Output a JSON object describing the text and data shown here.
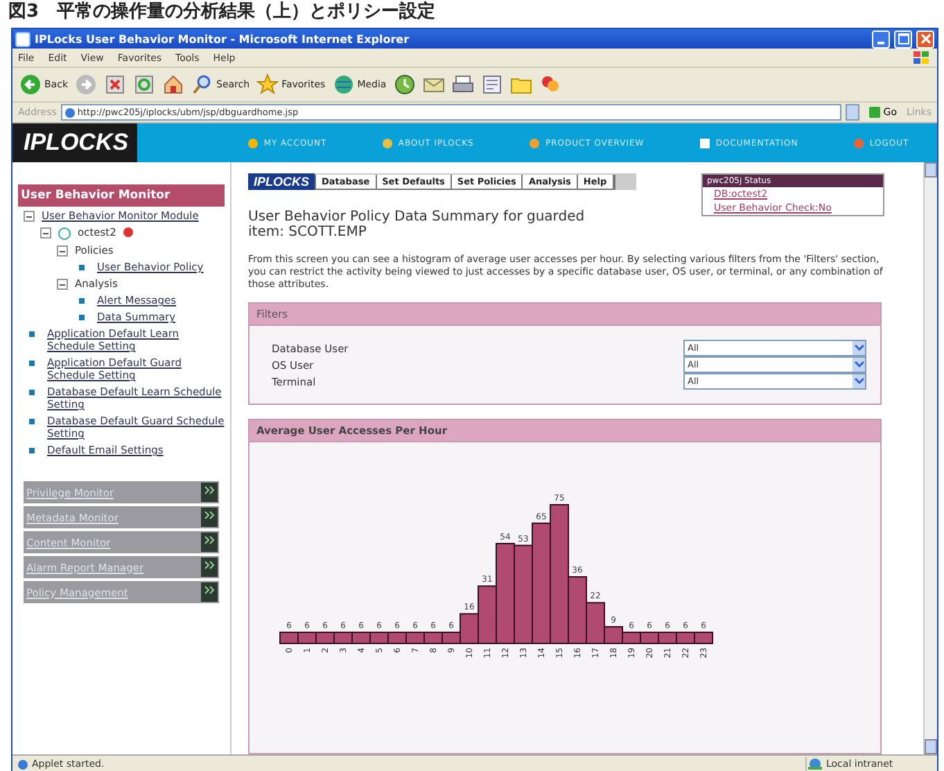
{
  "caption": "図3　平常の操作量の分析結果（上）とポリシー設定",
  "window": {
    "title": "IPLocks User Behavior Monitor - Microsoft Internet Explorer"
  },
  "menu": [
    "File",
    "Edit",
    "View",
    "Favorites",
    "Tools",
    "Help"
  ],
  "toolbar": [
    {
      "kind": "back",
      "label": "Back"
    },
    {
      "kind": "forward"
    },
    {
      "kind": "stop"
    },
    {
      "kind": "refresh"
    },
    {
      "kind": "home"
    },
    {
      "kind": "search",
      "label": "Search"
    },
    {
      "kind": "favorites",
      "label": "Favorites"
    },
    {
      "kind": "media",
      "label": "Media"
    },
    {
      "kind": "history"
    },
    {
      "kind": "mail"
    },
    {
      "kind": "print"
    },
    {
      "kind": "edit"
    },
    {
      "kind": "folder"
    },
    {
      "kind": "messenger"
    }
  ],
  "address": {
    "label": "Address",
    "value": "http://pwc205j/iplocks/ubm/jsp/dbguardhome.jsp",
    "go": "Go",
    "links": "Links"
  },
  "site": {
    "logo": "IPLOCKS",
    "nav": [
      {
        "kind": "account",
        "label": "MY ACCOUNT"
      },
      {
        "kind": "about",
        "label": "ABOUT IPLOCKS"
      },
      {
        "kind": "product",
        "label": "PRODUCT OVERVIEW"
      },
      {
        "kind": "docs",
        "label": "DOCUMENTATION"
      },
      {
        "kind": "logout",
        "label": "LOGOUT"
      }
    ]
  },
  "sidebar": {
    "title": "User Behavior Monitor",
    "tree": [
      {
        "kind": "node",
        "label": "User Behavior Monitor Module",
        "expanded": true,
        "children": [
          {
            "kind": "db",
            "label": "octest2",
            "expanded": true,
            "children": [
              {
                "kind": "group",
                "label": "Policies",
                "expanded": true,
                "children": [
                  {
                    "kind": "link",
                    "label": "User Behavior Policy"
                  }
                ]
              },
              {
                "kind": "group",
                "label": "Analysis",
                "expanded": true,
                "children": [
                  {
                    "kind": "link",
                    "label": "Alert Messages"
                  },
                  {
                    "kind": "link",
                    "label": "Data Summary"
                  }
                ]
              }
            ]
          }
        ]
      },
      {
        "kind": "link",
        "label": "Application Default Learn Schedule Setting"
      },
      {
        "kind": "link",
        "label": "Application Default Guard Schedule Setting"
      },
      {
        "kind": "link",
        "label": "Database Default Learn Schedule Setting"
      },
      {
        "kind": "link",
        "label": "Database Default Guard Schedule Setting"
      },
      {
        "kind": "link",
        "label": "Default Email Settings"
      }
    ],
    "monitors": [
      "Privilege Monitor",
      "Metadata Monitor",
      "Content Monitor",
      "Alarm Report Manager",
      "Policy Management"
    ]
  },
  "content": {
    "logo": "IPLOCKS",
    "tabs": [
      "Database",
      "Set Defaults",
      "Set Policies",
      "Analysis",
      "Help"
    ],
    "status_box": {
      "title": "pwc205j Status",
      "links": [
        "DB:octest2",
        "User Behavior Check:No"
      ]
    },
    "heading": "User Behavior Policy Data Summary for guarded item: SCOTT.EMP",
    "description": "From this screen you can see a histogram of average user accesses per hour. By selecting various filters from the 'Filters' section, you can restrict the activity being viewed to just accesses by a specific database user, OS user, or terminal, or any combination of those attributes.",
    "filters": {
      "title": "Filters",
      "rows": [
        {
          "label": "Database User",
          "value": "All"
        },
        {
          "label": "OS User",
          "value": "All"
        },
        {
          "label": "Terminal",
          "value": "All"
        }
      ]
    },
    "histogram": {
      "title": "Average User Accesses Per Hour",
      "chart_data": {
        "type": "bar",
        "categories": [
          "0",
          "1",
          "2",
          "3",
          "4",
          "5",
          "6",
          "7",
          "8",
          "9",
          "10",
          "11",
          "12",
          "13",
          "14",
          "15",
          "16",
          "17",
          "18",
          "19",
          "20",
          "21",
          "22",
          "23"
        ],
        "series": [
          {
            "color": "#b04a70",
            "values": [
              6,
              6,
              6,
              6,
              6,
              6,
              6,
              6,
              6,
              6,
              16,
              31,
              54,
              53,
              65,
              75,
              36,
              22,
              9,
              6,
              6,
              6,
              6,
              6
            ]
          }
        ],
        "ylim": [
          0,
          75
        ],
        "data_labels": true
      }
    }
  },
  "status_bar": {
    "text": "Applet started.",
    "zone": "Local intranet"
  }
}
